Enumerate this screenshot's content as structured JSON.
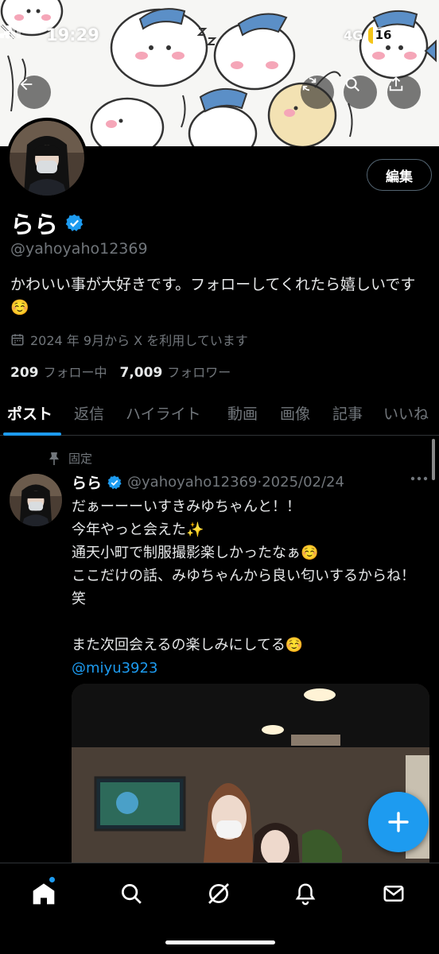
{
  "status_bar": {
    "time": "19:29",
    "network": "4G",
    "battery_level": "16",
    "battery_fraction": 0.16
  },
  "header": {
    "back_icon": "arrow-left-icon",
    "actions": [
      "refresh-icon",
      "search-icon",
      "share-icon"
    ]
  },
  "profile": {
    "display_name": "らら",
    "handle": "@yahoyaho12369",
    "bio": "かわいい事が大好きです。フォローしてくれたら嬉しいです☺️",
    "joined": "2024 年 9月から X を利用しています",
    "following_count": "209",
    "following_label": "フォロー中",
    "followers_count": "7,009",
    "followers_label": "フォロワー",
    "edit_button": "編集",
    "verified_color": "#1d9bf0"
  },
  "tabs": [
    {
      "label": "ポスト",
      "active": true
    },
    {
      "label": "返信",
      "active": false
    },
    {
      "label": "ハイライト",
      "active": false
    },
    {
      "label": "動画",
      "active": false
    },
    {
      "label": "画像",
      "active": false
    },
    {
      "label": "記事",
      "active": false
    },
    {
      "label": "いいね",
      "active": false
    }
  ],
  "pinned_post": {
    "pinned_label": "固定",
    "author_name": "らら",
    "author_handle": "@yahoyaho12369",
    "date_text": "·2025/02/24",
    "lines": [
      "だぁーーーいすきみゆちゃんと！！",
      "今年やっと会えた✨",
      "通天小町で制服撮影楽しかったなぁ☺️",
      "ここだけの話、みゆちゃんから良い匂いするからね！笑",
      "",
      "また次回会えるの楽しみにしてる☺️"
    ],
    "mention": "@miyu3923"
  },
  "bottom_nav": [
    "home-icon",
    "search-icon",
    "grok-icon",
    "notifications-icon",
    "messages-icon"
  ],
  "colors": {
    "accent": "#1d9bf0",
    "background": "#000000",
    "secondary_text": "#71767b"
  }
}
